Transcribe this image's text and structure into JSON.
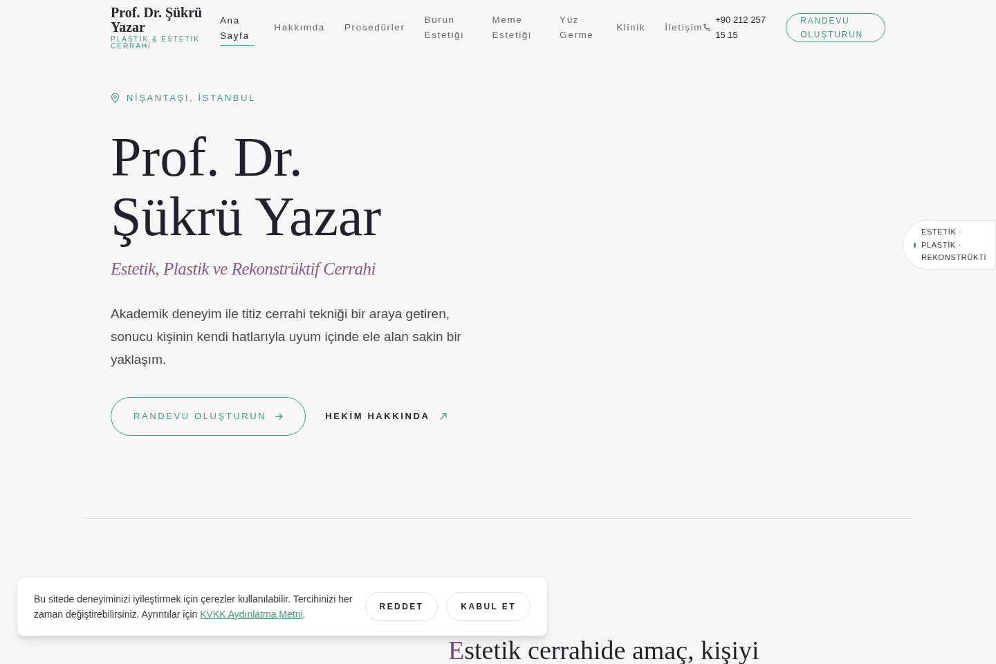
{
  "brand": {
    "name": "Prof. Dr. Şükrü Yazar",
    "tagline": "PLASTİK & ESTETİK CERRAHİ"
  },
  "nav": [
    {
      "label": "Ana Sayfa",
      "selected": true
    },
    {
      "label": "Hakkımda",
      "selected": false
    },
    {
      "label": "Prosedürler",
      "selected": false
    },
    {
      "label": "Burun Estetiği",
      "selected": false
    },
    {
      "label": "Meme Estetiği",
      "selected": false
    },
    {
      "label": "Yüz Germe",
      "selected": false
    },
    {
      "label": "Klinik",
      "selected": false
    },
    {
      "label": "İletişim",
      "selected": false
    }
  ],
  "phone": "+90 212 257 15 15",
  "header_button": "RANDEVU OLUŞTURUN",
  "hero": {
    "location": "NİŞANTAŞI, İSTANBUL",
    "title_lines": [
      "Prof. Dr.",
      "Şükrü Yazar"
    ],
    "subtitle": "Estetik, Plastik ve Rekonstrüktif Cerrahi",
    "description": "Akademik deneyim ile titiz cerrahi tekniği bir araya getiren, sonucu kişinin kendi hatlarıyla uyum içinde ele alan sakin bir yaklaşım.",
    "primary_button": "RANDEVU OLUŞTURUN",
    "secondary_link": "HEKİM HAKKINDA"
  },
  "side_pill": {
    "lines": [
      "ESTETİK ·",
      "PLASTİK ·",
      "REKONSTRÜKTİ"
    ],
    "color": "#3f9a7f"
  },
  "section_heading": "Estetik cerrahide amaç, kişiyi",
  "cookie": {
    "text": "Bu sitede deneyiminizi iyileştirmek için çerezler kullanılabilir. Tercihinizi her zaman değiştirebilirsiniz. Ayrıntılar için ",
    "link": "KVKK Aydınlatma Metni",
    "after": ".",
    "buttons": [
      "REDDET",
      "KABUL ET"
    ]
  }
}
